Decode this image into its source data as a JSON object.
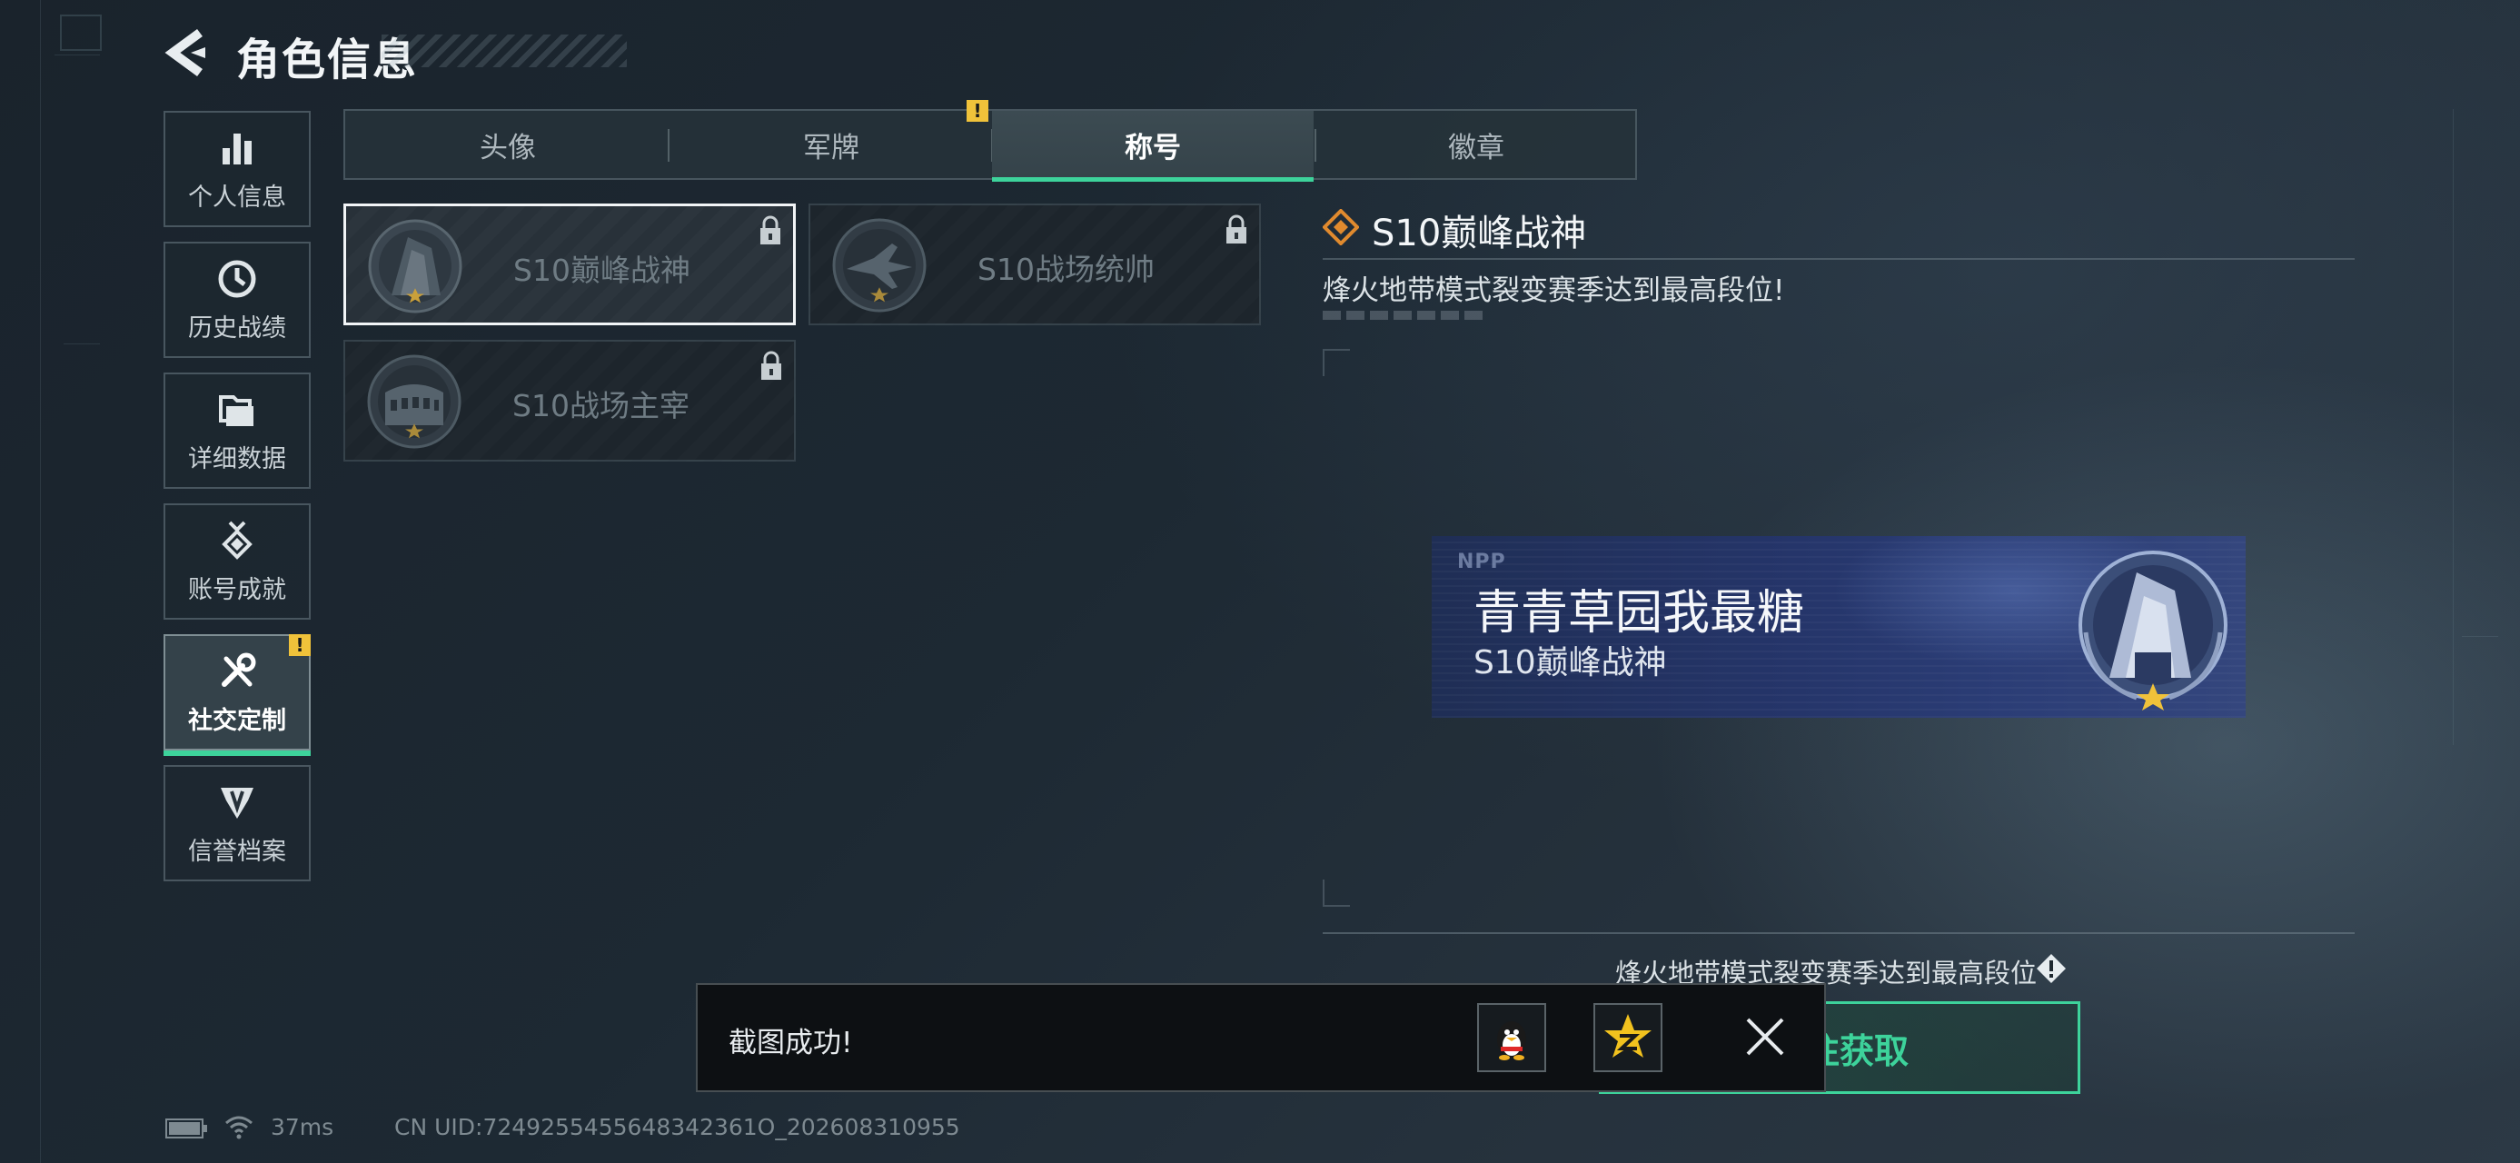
{
  "header": {
    "title": "角色信息"
  },
  "sidebar": {
    "items": [
      {
        "label": "个人信息",
        "icon": "bar-chart-icon"
      },
      {
        "label": "历史战绩",
        "icon": "clock-icon"
      },
      {
        "label": "详细数据",
        "icon": "folder-icon"
      },
      {
        "label": "账号成就",
        "icon": "medal-icon"
      },
      {
        "label": "社交定制",
        "icon": "tools-icon",
        "active": true,
        "badge": "!"
      },
      {
        "label": "信誉档案",
        "icon": "shield-emblem-icon"
      }
    ]
  },
  "tabs": {
    "items": [
      {
        "label": "头像"
      },
      {
        "label": "军牌",
        "badge": "!"
      },
      {
        "label": "称号",
        "active": true
      },
      {
        "label": "徽章"
      }
    ]
  },
  "titles": {
    "cards": [
      {
        "name": "S10巅峰战神",
        "selected": true,
        "locked": true,
        "emblem": "tower-emblem-icon"
      },
      {
        "name": "S10战场统帅",
        "selected": false,
        "locked": true,
        "emblem": "jet-emblem-icon"
      },
      {
        "name": "S10战场主宰",
        "selected": false,
        "locked": true,
        "emblem": "colosseum-emblem-icon"
      }
    ]
  },
  "detail": {
    "title": "S10巅峰战神",
    "description": "烽火地带模式裂变赛季达到最高段位!",
    "banner": {
      "logo_text": "NPP",
      "player_name": "青青草园我最糖",
      "title": "S10巅峰战神"
    },
    "requirement": "烽火地带模式裂变赛季达到最高段位",
    "action_label": "前往获取"
  },
  "toast": {
    "message": "截图成功!",
    "share_targets": [
      "qq-penguin-icon",
      "qzone-star-icon"
    ],
    "close_icon": "close-icon"
  },
  "status": {
    "ping": "37ms",
    "uid": "CN UID:7249255455648342361O_202608310955"
  },
  "colors": {
    "accent": "#3dd39b",
    "warning": "#f0c23a",
    "detail_icon": "#e08a2e"
  }
}
